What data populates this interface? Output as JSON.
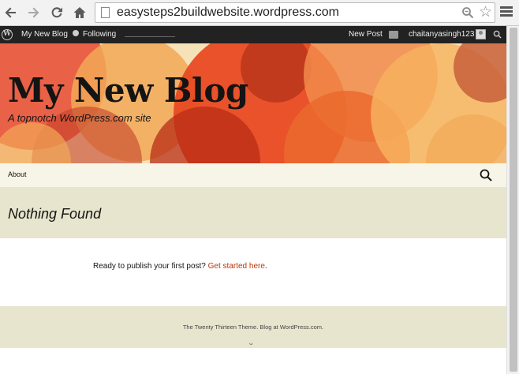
{
  "browser": {
    "url": "easysteps2buildwebsite.wordpress.com"
  },
  "adminbar": {
    "wp_logo": "W",
    "blog_link": "My New Blog",
    "following": "Following",
    "new_post": "New Post",
    "username": "chaitanyasingh123"
  },
  "header": {
    "title": "My New Blog",
    "description": "A topnotch WordPress.com site"
  },
  "nav": {
    "items": [
      {
        "label": "About"
      }
    ]
  },
  "page": {
    "title": "Nothing Found",
    "body_text": "Ready to publish your first post? ",
    "body_link": "Get started here",
    "body_end": "."
  },
  "footer": {
    "credit_theme": "The Twenty Thirteen Theme.",
    "credit_blog": "Blog at WordPress.com.",
    "mark": "ᴗ"
  },
  "colors": {
    "adminbar_bg": "#222222",
    "nav_bg": "#f7f5e7",
    "page_header_bg": "#e8e5ce",
    "link": "#bc360a"
  }
}
